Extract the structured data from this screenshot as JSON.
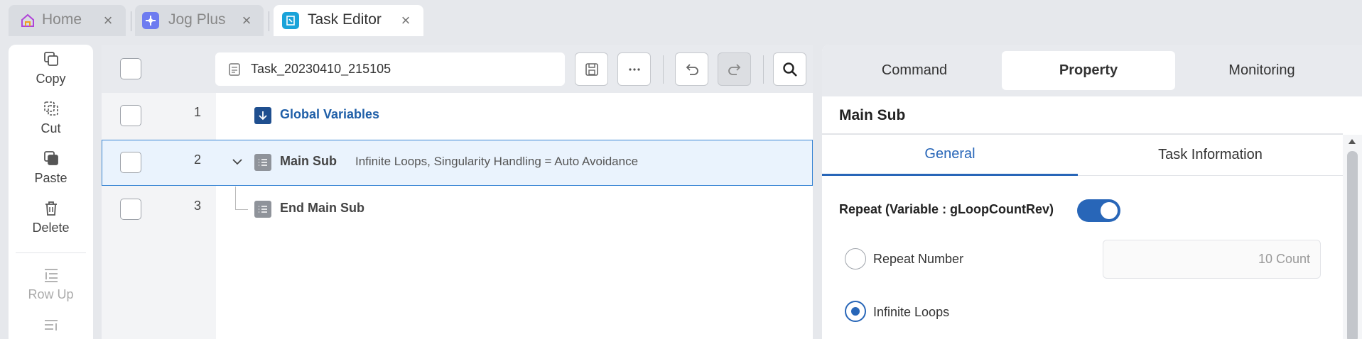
{
  "tabs": [
    {
      "label": "Home",
      "icon": "home-icon",
      "active": false
    },
    {
      "label": "Jog Plus",
      "icon": "jog-icon",
      "active": false
    },
    {
      "label": "Task Editor",
      "icon": "task-editor-icon",
      "active": true
    }
  ],
  "tools": {
    "copy": "Copy",
    "cut": "Cut",
    "paste": "Paste",
    "delete": "Delete",
    "row_up": "Row Up"
  },
  "editor": {
    "task_name": "Task_20230410_215105",
    "rows": [
      {
        "num": "1",
        "title": "Global Variables",
        "desc": ""
      },
      {
        "num": "2",
        "title": "Main Sub",
        "desc": "Infinite Loops, Singularity Handling = Auto Avoidance"
      },
      {
        "num": "3",
        "title": "End Main Sub",
        "desc": ""
      }
    ]
  },
  "panel": {
    "tabs": [
      "Command",
      "Property",
      "Monitoring"
    ],
    "active_tab": "Property",
    "title": "Main Sub",
    "subtabs": [
      "General",
      "Task Information"
    ],
    "repeat_label": "Repeat (Variable : gLoopCountRev)",
    "repeat_enabled": true,
    "repeat_number_label": "Repeat Number",
    "count_value": "10 Count",
    "infinite_label": "Infinite Loops",
    "selected_option": "Infinite Loops"
  },
  "colors": {
    "accent": "#2866b8",
    "selection": "#eaf3fd",
    "global_blue": "#1f4f8f"
  }
}
